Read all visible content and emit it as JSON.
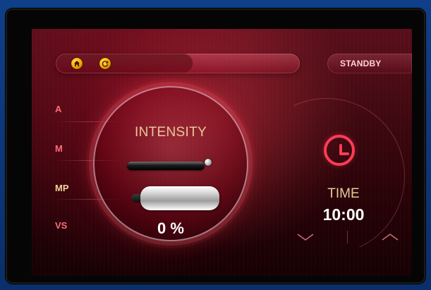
{
  "topbar": {
    "home_icon": "home-icon",
    "refresh_icon": "refresh-icon",
    "status_label": "STANDBY"
  },
  "modes": [
    {
      "label": "A",
      "active": false
    },
    {
      "label": "M",
      "active": false
    },
    {
      "label": "MP",
      "active": true
    },
    {
      "label": "VS",
      "active": false
    }
  ],
  "intensity": {
    "title": "INTENSITY",
    "value": "0 %"
  },
  "time": {
    "icon": "clock-icon",
    "label": "TIME",
    "value": "10:00",
    "down_icon": "chevron-down-icon",
    "up_icon": "chevron-up-icon"
  },
  "colors": {
    "accent_red": "#ff3b57",
    "text_gold": "#e8c89a",
    "mode_red": "#ff6c78",
    "active_gold": "#f0d49a"
  }
}
